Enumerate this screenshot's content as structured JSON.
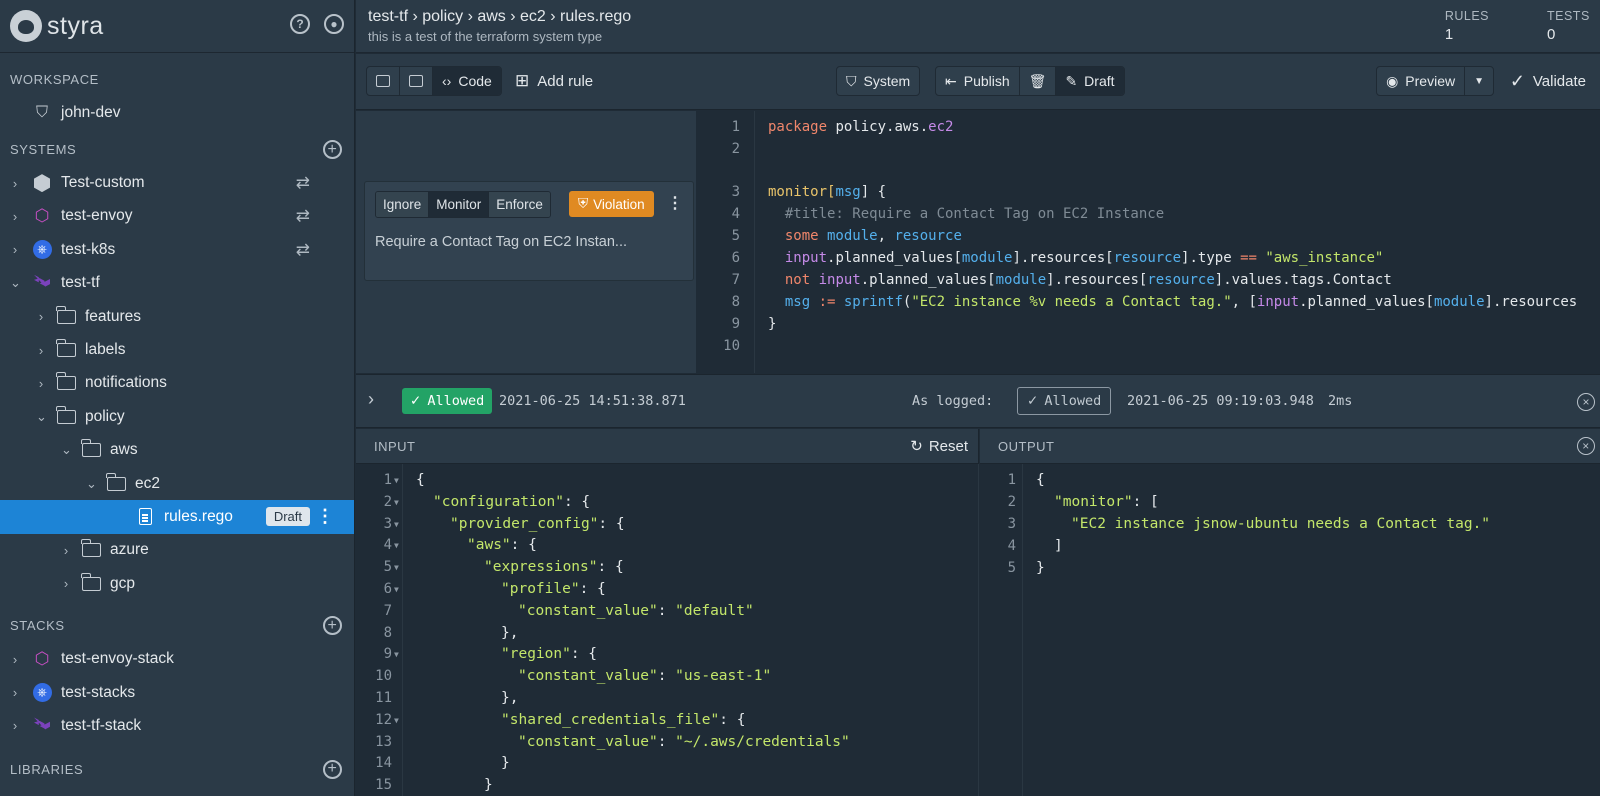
{
  "sidebar": {
    "brand": "styra",
    "sections": {
      "workspace": "WORKSPACE",
      "systems": "SYSTEMS",
      "stacks": "STACKS",
      "libraries": "LIBRARIES"
    },
    "workspace_item": "john-dev",
    "systems": [
      "Test-custom",
      "test-envoy",
      "test-k8s",
      "test-tf"
    ],
    "tf_children": [
      "features",
      "labels",
      "notifications",
      "policy"
    ],
    "policy_children": [
      "aws",
      "azure",
      "gcp"
    ],
    "aws_children": [
      "ec2"
    ],
    "selected_file": "rules.rego",
    "selected_badge": "Draft",
    "stacks": [
      "test-envoy-stack",
      "test-stacks",
      "test-tf-stack"
    ]
  },
  "header": {
    "breadcrumb": "test-tf › policy › aws › ec2 › rules.rego",
    "subtitle": "this is a test of the terraform system type",
    "rules_label": "RULES",
    "rules_value": "1",
    "tests_label": "TESTS",
    "tests_value": "0"
  },
  "toolbar": {
    "code_label": "Code",
    "add_rule_label": "Add rule",
    "system_label": "System",
    "publish_label": "Publish",
    "draft_label": "Draft",
    "preview_label": "Preview",
    "validate_label": "Validate"
  },
  "rule_card": {
    "modes": [
      "Ignore",
      "Monitor",
      "Enforce"
    ],
    "active_mode": "Monitor",
    "violation_label": "Violation",
    "title": "Require a Contact Tag on EC2 Instan..."
  },
  "code": {
    "line_numbers": [
      "1",
      "2",
      "3",
      "4",
      "5",
      "6",
      "7",
      "8",
      "9",
      "10"
    ],
    "l1_kw": "package",
    "l1_a": " policy.aws.",
    "l1_b": "ec2",
    "l3_a": "monitor[",
    "l3_b": "msg",
    "l3_c": "] {",
    "l4": "  #title: Require a Contact Tag on EC2 Instance",
    "l5_kw": "  some",
    "l5_a": " module",
    "l5_b": ", ",
    "l5_c": "resource",
    "l6_a": "  input",
    "l6_b": ".planned_values[",
    "l6_c": "module",
    "l6_d": "].resources[",
    "l6_e": "resource",
    "l6_f": "].type ",
    "l6_g": "==",
    "l6_h": " \"aws_instance\"",
    "l7_kw": "  not",
    "l7_a": " input",
    "l7_b": ".planned_values[",
    "l7_c": "module",
    "l7_d": "].resources[",
    "l7_e": "resource",
    "l7_f": "].values.tags.Contact",
    "l8_a": "  msg",
    "l8_b": " := ",
    "l8_c": "sprintf",
    "l8_d": "(",
    "l8_e": "\"EC2 instance %v needs a Contact tag.\"",
    "l8_f": ", [",
    "l8_g": "input",
    "l8_h": ".planned_values[",
    "l8_i": "module",
    "l8_j": "].resources",
    "l9": "}"
  },
  "result": {
    "status": "Allowed",
    "timestamp": "2021-06-25 14:51:38.871",
    "as_logged_label": "As logged:",
    "logged_status": "Allowed",
    "logged_timestamp": "2021-06-25 09:19:03.948",
    "duration": "2ms"
  },
  "input": {
    "title": "INPUT",
    "reset_label": "Reset",
    "line_numbers": [
      "1",
      "2",
      "3",
      "4",
      "5",
      "6",
      "7",
      "8",
      "9",
      "10",
      "11",
      "12",
      "13",
      "14",
      "15"
    ],
    "lines": [
      {
        "k": "",
        "v": "{"
      },
      {
        "k": "\"configuration\"",
        "v": ": {"
      },
      {
        "k": "\"provider_config\"",
        "v": ": {"
      },
      {
        "k": "\"aws\"",
        "v": ": {"
      },
      {
        "k": "\"expressions\"",
        "v": ": {"
      },
      {
        "k": "\"profile\"",
        "v": ": {"
      },
      {
        "k": "\"constant_value\"",
        "v": ": ",
        "s": "\"default\""
      },
      {
        "k": "",
        "v": "},"
      },
      {
        "k": "\"region\"",
        "v": ": {"
      },
      {
        "k": "\"constant_value\"",
        "v": ": ",
        "s": "\"us-east-1\""
      },
      {
        "k": "",
        "v": "},"
      },
      {
        "k": "\"shared_credentials_file\"",
        "v": ": {"
      },
      {
        "k": "\"constant_value\"",
        "v": ": ",
        "s": "\"~/.aws/credentials\""
      },
      {
        "k": "",
        "v": "}"
      },
      {
        "k": "",
        "v": "}"
      }
    ]
  },
  "output": {
    "title": "OUTPUT",
    "line_numbers": [
      "1",
      "2",
      "3",
      "4",
      "5"
    ],
    "l1": "{",
    "l2_k": "\"monitor\"",
    "l2_v": ": [",
    "l3": "\"EC2 instance jsnow-ubuntu needs a Contact tag.\"",
    "l4": "]",
    "l5": "}"
  },
  "colors": {
    "accent": "#1d84d6",
    "allowed": "#23a366",
    "violation": "#e08a22"
  }
}
